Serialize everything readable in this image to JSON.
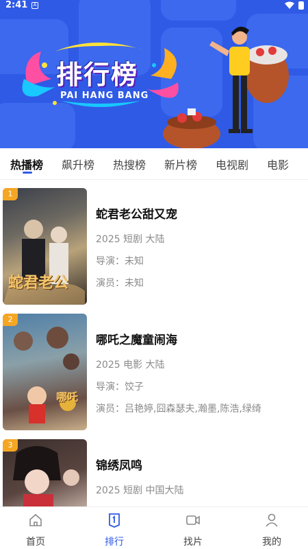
{
  "status_bar": {
    "time": "2:41",
    "notification_badge": "A"
  },
  "banner": {
    "title": "排行榜",
    "subtitle": "PAI HANG BANG"
  },
  "tabs": [
    {
      "label": "热播榜",
      "active": true
    },
    {
      "label": "飙升榜"
    },
    {
      "label": "热搜榜"
    },
    {
      "label": "新片榜"
    },
    {
      "label": "电视剧"
    },
    {
      "label": "电影"
    }
  ],
  "list": [
    {
      "rank": "1",
      "title": "蛇君老公甜又宠",
      "meta": "2025 短剧 大陆",
      "director": "导演：未知",
      "cast": "演员：未知",
      "poster_text": "蛇君老公"
    },
    {
      "rank": "2",
      "title": "哪吒之魔童闹海",
      "meta": "2025 电影 大陆",
      "director": "导演：饺子",
      "cast": "演员：吕艳婷,囧森瑟夫,瀚墨,陈浩,绿绮",
      "poster_text": "哪吒"
    },
    {
      "rank": "3",
      "title": "锦绣凤鸣",
      "meta": "2025 短剧 中国大陆",
      "director": "",
      "cast": "",
      "poster_text": ""
    }
  ],
  "bottom_nav": [
    {
      "label": "首页",
      "icon": "home-icon"
    },
    {
      "label": "排行",
      "icon": "ranking-icon",
      "active": true
    },
    {
      "label": "找片",
      "icon": "video-icon"
    },
    {
      "label": "我的",
      "icon": "user-icon"
    }
  ],
  "colors": {
    "accent": "#2f5ae6",
    "rank_badge": "#f5a623",
    "muted_text": "#8a8a8a"
  }
}
